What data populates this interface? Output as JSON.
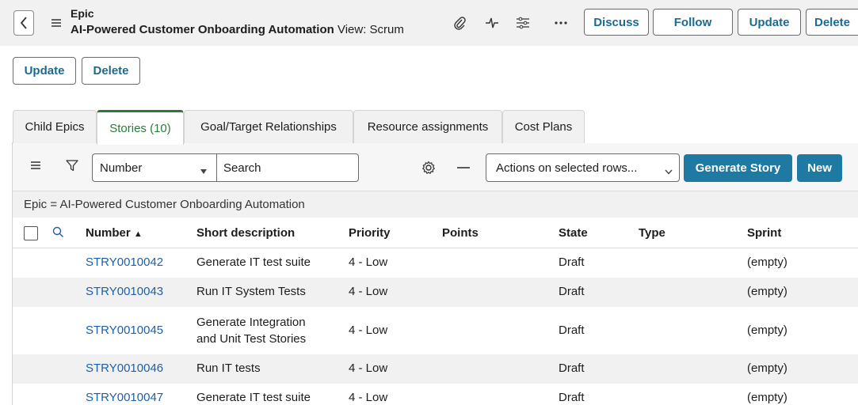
{
  "header": {
    "record_type": "Epic",
    "title": "AI-Powered Customer Onboarding Automation",
    "view_label": "View: Scrum",
    "buttons": {
      "discuss": "Discuss",
      "follow": "Follow",
      "update": "Update",
      "delete": "Delete"
    },
    "icons": [
      "back-icon",
      "menu-icon",
      "paperclip-icon",
      "activity-icon",
      "sliders-icon",
      "more-icon"
    ]
  },
  "form_actions": {
    "update": "Update",
    "delete": "Delete"
  },
  "tabs": [
    {
      "label": "Child Epics",
      "active": false
    },
    {
      "label": "Stories (10)",
      "active": true
    },
    {
      "label": "Goal/Target Relationships",
      "active": false
    },
    {
      "label": "Resource assignments",
      "active": false
    },
    {
      "label": "Cost Plans",
      "active": false
    }
  ],
  "list": {
    "search_field": "Number",
    "search_placeholder": "Search",
    "actions_select": "Actions on selected rows...",
    "generate_story": "Generate Story",
    "new": "New",
    "filter": "Epic = AI-Powered Customer Onboarding Automation",
    "sort_indicator": "▲",
    "columns": [
      "Number",
      "Short description",
      "Priority",
      "Points",
      "State",
      "Type",
      "Sprint"
    ],
    "rows": [
      {
        "number": "STRY0010042",
        "desc": "Generate IT test suite",
        "priority": "4 - Low",
        "points": "",
        "state": "Draft",
        "type": "",
        "sprint": "(empty)"
      },
      {
        "number": "STRY0010043",
        "desc": "Run IT System Tests",
        "priority": "4 - Low",
        "points": "",
        "state": "Draft",
        "type": "",
        "sprint": "(empty)"
      },
      {
        "number": "STRY0010045",
        "desc": "Generate Integration and Unit Test Stories",
        "priority": "4 - Low",
        "points": "",
        "state": "Draft",
        "type": "",
        "sprint": "(empty)"
      },
      {
        "number": "STRY0010046",
        "desc": "Run IT tests",
        "priority": "4 - Low",
        "points": "",
        "state": "Draft",
        "type": "",
        "sprint": "(empty)"
      },
      {
        "number": "STRY0010047",
        "desc": "Generate IT test suite",
        "priority": "4 - Low",
        "points": "",
        "state": "Draft",
        "type": "",
        "sprint": "(empty)"
      }
    ]
  },
  "colors": {
    "link": "#1f5fa8",
    "primary_button": "#1f7aa3",
    "active_tab": "#2c7a3a"
  }
}
